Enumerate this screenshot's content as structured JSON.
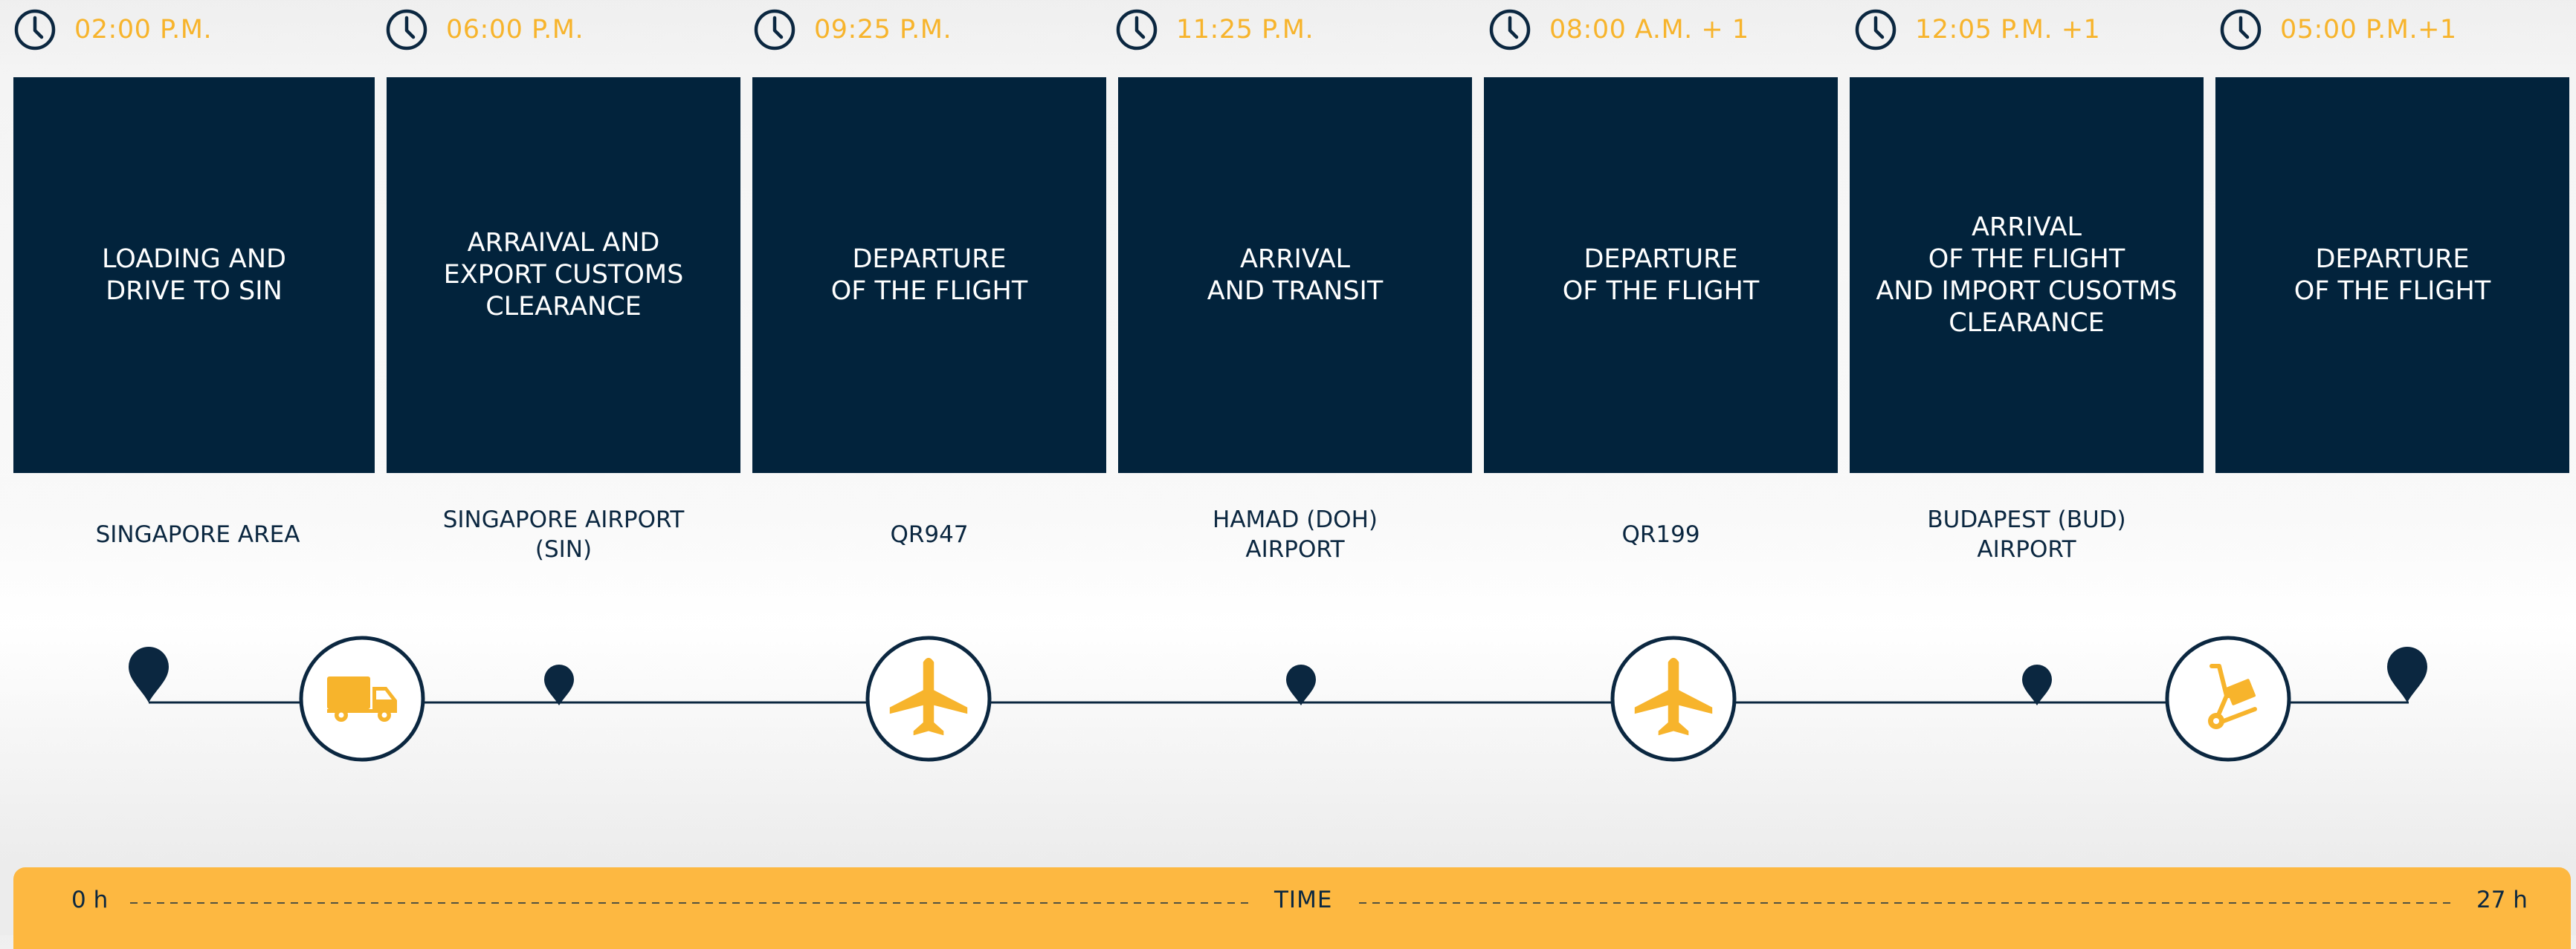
{
  "steps": [
    {
      "time": "02:00 P.M.",
      "title": "LOADING AND\nDRIVE TO SIN",
      "location": "SINGAPORE AREA"
    },
    {
      "time": "06:00 P.M.",
      "title": "ARRAIVAL AND\nEXPORT CUSTOMS\nCLEARANCE",
      "location": "SINGAPORE AIRPORT\n(SIN)"
    },
    {
      "time": "09:25 P.M.",
      "title": "DEPARTURE\nOF THE FLIGHT",
      "location": "QR947"
    },
    {
      "time": "11:25 P.M.",
      "title": "ARRIVAL\nAND TRANSIT",
      "location": "HAMAD (DOH)\nAIRPORT"
    },
    {
      "time": "08:00 A.M. + 1",
      "title": "DEPARTURE\nOF THE FLIGHT",
      "location": "QR199"
    },
    {
      "time": "12:05 P.M. +1",
      "title": "ARRIVAL\nOF THE FLIGHT\nAND IMPORT CUSOTMS\nCLEARANCE",
      "location": "BUDAPEST (BUD)\nAIRPORT"
    },
    {
      "time": "05:00 P.M.+1",
      "title": "DEPARTURE\nOF THE FLIGHT",
      "location": ""
    }
  ],
  "timeline_icons": [
    "truck-icon",
    "airplane-icon",
    "airplane-icon",
    "hand-truck-icon"
  ],
  "time_bar": {
    "start": "0 h",
    "label": "TIME",
    "end": "27 h"
  },
  "colors": {
    "navy": "#02233c",
    "accent": "#f7b42c",
    "bar": "#fdb841",
    "line": "#0b2740"
  }
}
